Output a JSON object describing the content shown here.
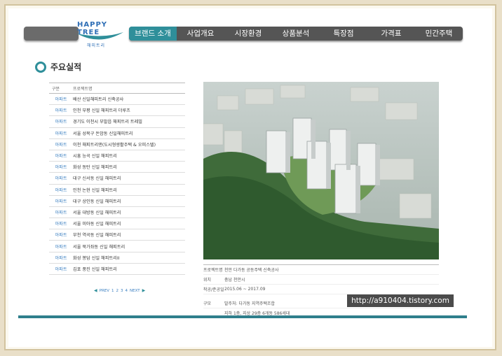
{
  "logo": {
    "text": "HAPPY TREE",
    "sub": "해피트리"
  },
  "nav": {
    "items": [
      "브랜드 소개",
      "사업개요",
      "시장환경",
      "상품분석",
      "특장점",
      "가격표",
      "민간주택"
    ]
  },
  "section": {
    "title": "주요실적"
  },
  "list": {
    "headers": {
      "type": "구분",
      "name": "프로젝트명"
    },
    "rows": [
      {
        "type": "아파트",
        "name": "배산 신일해피트리 신축공사"
      },
      {
        "type": "아파트",
        "name": "인천 부평 신일 해피트리 더루츠"
      },
      {
        "type": "아파트",
        "name": "경기도 이천시 부발읍 해피트리 트레빌"
      },
      {
        "type": "아파트",
        "name": "서울 성북구 돈암동 신일해피트리"
      },
      {
        "type": "아파트",
        "name": "이천 해피트리앤(도시형생활주택 & 오피스텔)"
      },
      {
        "type": "아파트",
        "name": "시흥 능곡 신일 해피트리"
      },
      {
        "type": "아파트",
        "name": "화성 동탄 신일 해피트리"
      },
      {
        "type": "아파트",
        "name": "대구 신서동 신일 해피트리"
      },
      {
        "type": "아파트",
        "name": "인천 논현 신일 해피트리"
      },
      {
        "type": "아파트",
        "name": "대구 상인동 신일 해피트리"
      },
      {
        "type": "아파트",
        "name": "서울 대방동 신일 해피트리"
      },
      {
        "type": "아파트",
        "name": "서울 미아동 신일 해피트리"
      },
      {
        "type": "아파트",
        "name": "부천 역곡동 신일 해피트리"
      },
      {
        "type": "아파트",
        "name": "서울 북가좌동 신일 해피트리"
      },
      {
        "type": "아파트",
        "name": "화성 봉담 신일 해피트리II"
      },
      {
        "type": "아파트",
        "name": "김포 풍진 신일 해피트리"
      }
    ]
  },
  "pager": {
    "prev": "PREV",
    "pages": [
      "1",
      "2",
      "3",
      "4"
    ],
    "next": "NEXT"
  },
  "info": {
    "rows": [
      {
        "k": "프로젝트명",
        "v": "천안 다가동 공동주택 신축공사"
      },
      {
        "k": "위치",
        "v": "충남 천안시"
      },
      {
        "k": "착공/준공일",
        "v": "2015.06 ~ 2017.09"
      },
      {
        "k": "구모",
        "v": "발주처: 다가동 지역주택조합"
      },
      {
        "k": "",
        "v": "지하 1층, 지상 29층 6개동 586세대"
      }
    ]
  },
  "watermark": "http://a910404.tistory.com",
  "colors": {
    "accent": "#2f8f9a",
    "nav_bg": "#555555",
    "link": "#3a7fc1"
  }
}
